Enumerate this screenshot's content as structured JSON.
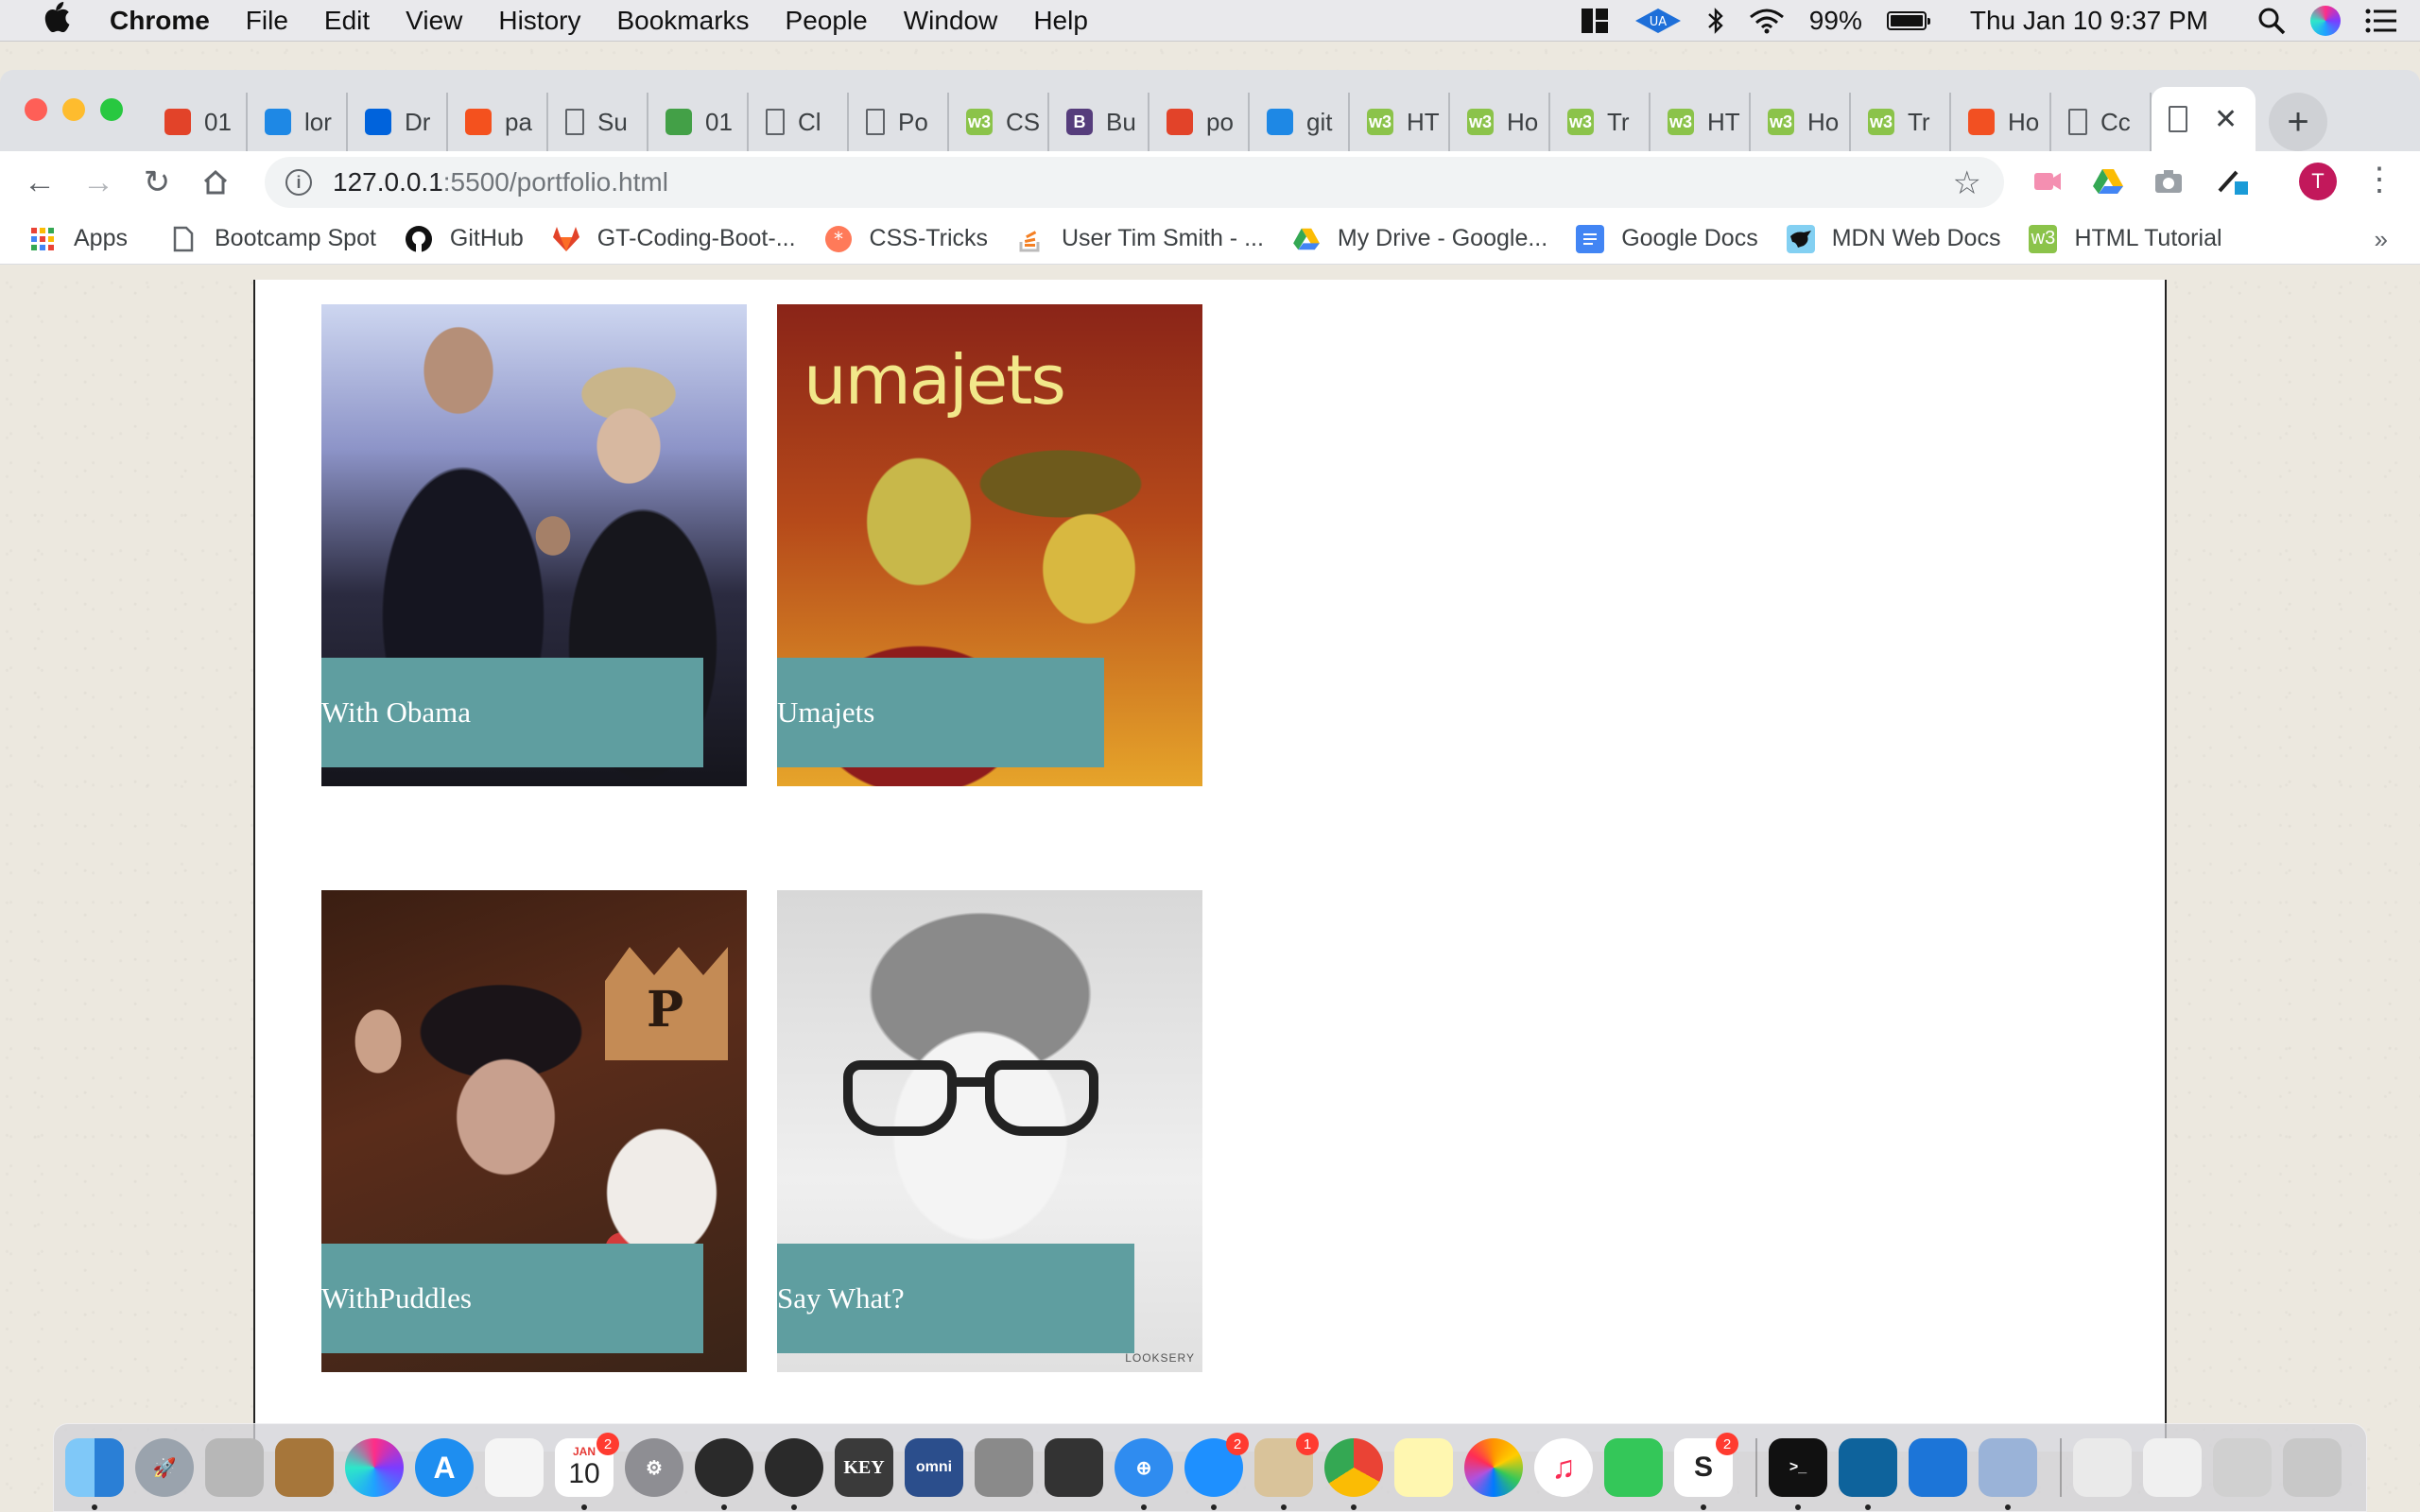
{
  "menubar": {
    "apple": "",
    "app_name": "Chrome",
    "menus": [
      "File",
      "Edit",
      "View",
      "History",
      "Bookmarks",
      "People",
      "Window",
      "Help"
    ],
    "battery_percent": "99%",
    "clock": "Thu Jan 10  9:37 PM"
  },
  "tabs": [
    {
      "label": "01",
      "icon": "gitlab-icon",
      "color": "#e24329"
    },
    {
      "label": "lor",
      "icon": "grid-icon",
      "color": "#1e88e5"
    },
    {
      "label": "Dr",
      "icon": "flickr-icon",
      "color": "#0063dc"
    },
    {
      "label": "pa",
      "icon": "codepen-icon",
      "color": "#f4511e"
    },
    {
      "label": "Su",
      "icon": "document-icon",
      "color": "#5f6368"
    },
    {
      "label": "01",
      "icon": "clover-icon",
      "color": "#43a047"
    },
    {
      "label": "Cl",
      "icon": "document-icon",
      "color": "#5f6368"
    },
    {
      "label": "Po",
      "icon": "document-icon",
      "color": "#5f6368"
    },
    {
      "label": "CS",
      "icon": "w3schools-icon",
      "color": "#8bc34a"
    },
    {
      "label": "Bu",
      "icon": "bootstrap-icon",
      "color": "#563d7c"
    },
    {
      "label": "po",
      "icon": "gitlab-icon",
      "color": "#e24329"
    },
    {
      "label": "git",
      "icon": "dots-icon",
      "color": "#1e88e5"
    },
    {
      "label": "HT",
      "icon": "w3schools-icon",
      "color": "#8bc34a"
    },
    {
      "label": "Ho",
      "icon": "w3schools-icon",
      "color": "#8bc34a"
    },
    {
      "label": "Tr",
      "icon": "w3schools-icon",
      "color": "#8bc34a"
    },
    {
      "label": "HT",
      "icon": "w3schools-icon",
      "color": "#8bc34a"
    },
    {
      "label": "Ho",
      "icon": "w3schools-icon",
      "color": "#8bc34a"
    },
    {
      "label": "Tr",
      "icon": "w3schools-icon",
      "color": "#8bc34a"
    },
    {
      "label": "Ho",
      "icon": "microsoft-icon",
      "color": "#f25022"
    },
    {
      "label": "Cc",
      "icon": "document-icon",
      "color": "#5f6368"
    }
  ],
  "active_tab": {
    "label": "",
    "icon": "document-icon",
    "close": "✕"
  },
  "toolbar": {
    "url_host": "127.0.0.1",
    "url_path": ":5500/portfolio.html",
    "profile_initial": "T"
  },
  "bookmarks": [
    {
      "label": "Apps",
      "icon": "apps-grid-icon"
    },
    {
      "label": "Bootcamp Spot",
      "icon": "document-icon"
    },
    {
      "label": "GitHub",
      "icon": "github-icon"
    },
    {
      "label": "GT-Coding-Boot-...",
      "icon": "gitlab-icon"
    },
    {
      "label": "CSS-Tricks",
      "icon": "css-tricks-icon"
    },
    {
      "label": "User Tim Smith - ...",
      "icon": "stackoverflow-icon"
    },
    {
      "label": "My Drive - Google...",
      "icon": "google-drive-icon"
    },
    {
      "label": "Google Docs",
      "icon": "google-docs-icon"
    },
    {
      "label": "MDN Web Docs",
      "icon": "mdn-icon"
    },
    {
      "label": "HTML Tutorial",
      "icon": "w3schools-icon"
    }
  ],
  "bookmarks_more": "»",
  "portfolio": {
    "cards": [
      {
        "caption": "With Obama",
        "photo": "obama-photo"
      },
      {
        "caption": "Umajets",
        "photo": "umajets-photo",
        "photo_text": "umajets"
      },
      {
        "caption": "WithPuddles",
        "photo": "puddles-photo",
        "photo_text": "P"
      },
      {
        "caption": "Say What?",
        "photo": "saywhat-photo",
        "photo_text": "LOOKSERY"
      }
    ],
    "caption_color": "#5f9ea0"
  },
  "dock": {
    "calendar_month": "JAN",
    "calendar_day": "10",
    "calendar_badge": "2",
    "messages_badge": "2",
    "mail_badge": "1",
    "slack_badge": "2",
    "keynote_label": "KEY",
    "omni_label": "omni"
  }
}
